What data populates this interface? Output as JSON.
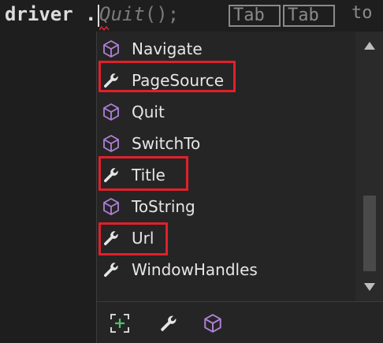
{
  "editor": {
    "identifier": "driver",
    "dot": ".",
    "ghost_member": "Quit",
    "ghost_suffix": "();",
    "tab_hint_1": "Tab",
    "tab_hint_2": "Tab",
    "to_hint": "to"
  },
  "completion": {
    "items": [
      {
        "label": "Navigate",
        "icon": "method-cube-icon",
        "highlighted": false
      },
      {
        "label": "PageSource",
        "icon": "property-wrench-icon",
        "highlighted": true
      },
      {
        "label": "Quit",
        "icon": "method-cube-icon",
        "highlighted": false
      },
      {
        "label": "SwitchTo",
        "icon": "method-cube-icon",
        "highlighted": false
      },
      {
        "label": "Title",
        "icon": "property-wrench-icon",
        "highlighted": true
      },
      {
        "label": "ToString",
        "icon": "method-cube-icon",
        "highlighted": false
      },
      {
        "label": "Url",
        "icon": "property-wrench-icon",
        "highlighted": true
      },
      {
        "label": "WindowHandles",
        "icon": "property-wrench-icon",
        "highlighted": false
      }
    ],
    "footer_filters": [
      "expand-filter-icon",
      "property-wrench-icon",
      "method-cube-icon"
    ]
  },
  "colors": {
    "background": "#1e1e1e",
    "popup": "#252526",
    "highlight": "#e0202a",
    "cube": "#b180d7",
    "wrench": "#e6e6e6",
    "expand": "#4ec26a"
  }
}
